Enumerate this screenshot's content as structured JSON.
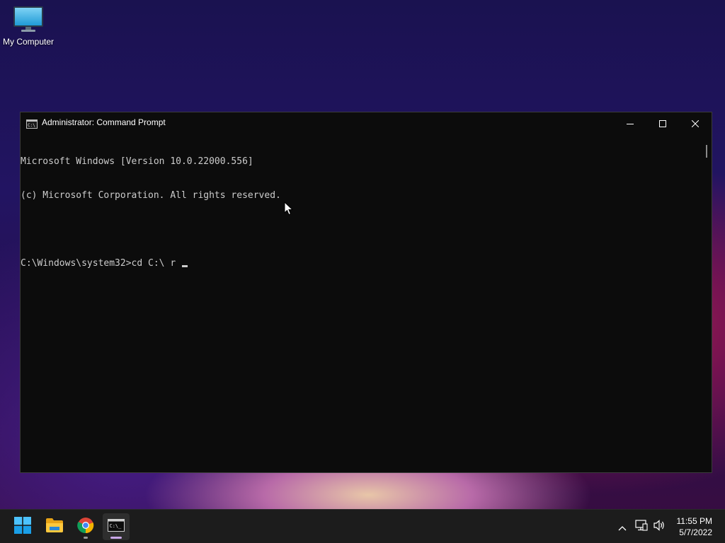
{
  "desktop": {
    "icons": [
      {
        "label": "My Computer",
        "icon": "monitor-icon"
      }
    ]
  },
  "window": {
    "title": "Administrator: Command Prompt",
    "icon": "cmd-icon",
    "controls": {
      "minimize": "minimize-icon",
      "maximize": "maximize-icon",
      "close": "close-icon"
    },
    "console_lines": [
      "Microsoft Windows [Version 10.0.22000.556]",
      "(c) Microsoft Corporation. All rights reserved.",
      "",
      "C:\\Windows\\system32>cd C:\\ r "
    ],
    "colors": {
      "background": "#0c0c0c",
      "text": "#cccccc"
    }
  },
  "taskbar": {
    "items": [
      {
        "name": "start",
        "icon": "windows-logo-icon"
      },
      {
        "name": "file-explorer",
        "icon": "folder-icon"
      },
      {
        "name": "chrome",
        "icon": "chrome-icon"
      },
      {
        "name": "command-prompt",
        "icon": "cmd-icon",
        "active": true
      }
    ],
    "tray": {
      "icons": [
        "chevron-up-icon",
        "network-icon",
        "volume-icon"
      ]
    },
    "clock": {
      "time": "11:55 PM",
      "date": "5/7/2022"
    },
    "colors": {
      "background": "#1c1c1c",
      "accent": "#2b88d8"
    }
  }
}
